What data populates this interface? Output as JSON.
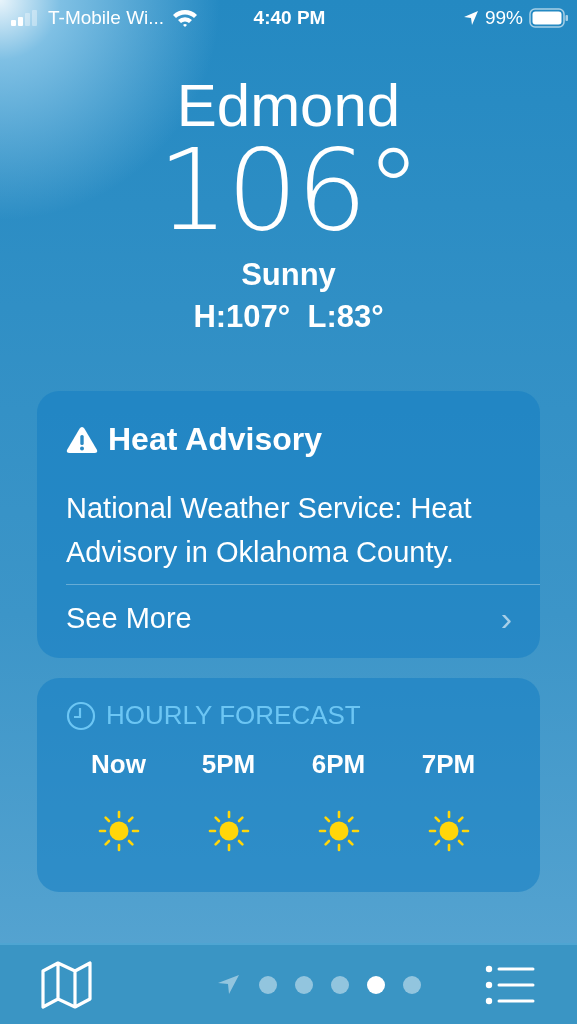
{
  "status_bar": {
    "carrier": "T-Mobile Wi...",
    "time": "4:40 PM",
    "battery": "99%"
  },
  "current": {
    "city": "Edmond",
    "temperature": "106°",
    "condition": "Sunny",
    "high_low": "H:107°  L:83°"
  },
  "alert": {
    "title": "Heat Advisory",
    "message": "National Weather Service: Heat Advisory in Oklahoma County.",
    "link": "See More",
    "chevron": "›"
  },
  "hourly": {
    "title": "HOURLY FORECAST",
    "hours": [
      {
        "time": "Now"
      },
      {
        "time": "5PM"
      },
      {
        "time": "6PM"
      },
      {
        "time": "7PM"
      }
    ]
  },
  "pages": [
    {
      "kind": "location",
      "selected": false
    },
    {
      "kind": "dot",
      "selected": false
    },
    {
      "kind": "dot",
      "selected": false
    },
    {
      "kind": "dot",
      "selected": false
    },
    {
      "kind": "dot",
      "selected": true
    },
    {
      "kind": "dot",
      "selected": false
    }
  ]
}
